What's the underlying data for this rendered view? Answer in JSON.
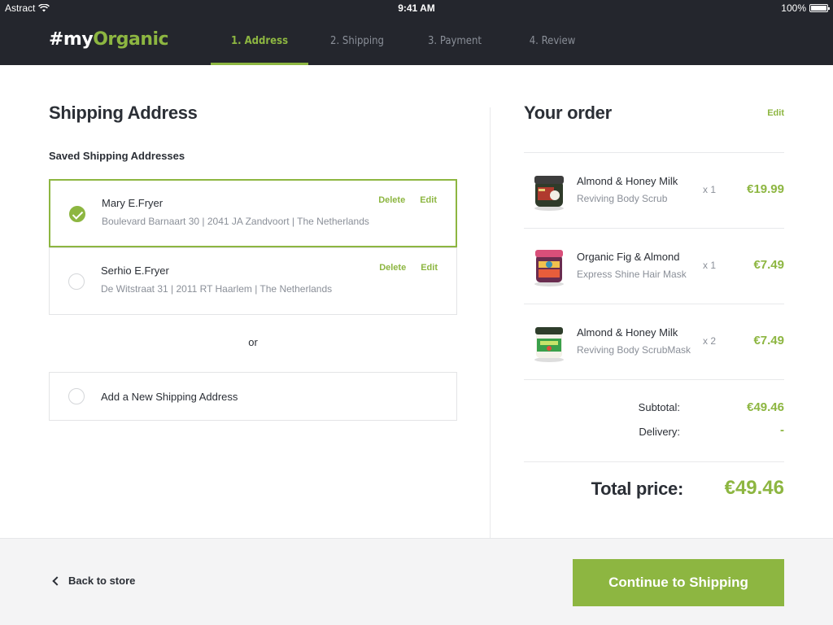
{
  "status_bar": {
    "carrier": "Astract",
    "time": "9:41 AM",
    "battery": "100%"
  },
  "brand": {
    "part1": "#my",
    "part2": "Organic",
    "accent": "#8db641"
  },
  "steps": [
    {
      "label": "1. Address",
      "active": true
    },
    {
      "label": "2. Shipping",
      "active": false
    },
    {
      "label": "3. Payment",
      "active": false
    },
    {
      "label": "4. Review",
      "active": false
    }
  ],
  "shipping": {
    "title": "Shipping Address",
    "saved_title": "Saved Shipping Addresses",
    "addresses": [
      {
        "name": "Mary E.Fryer",
        "line": "Boulevard Barnaart 30  |  2041 JA Zandvoort   |  The Netherlands",
        "delete": "Delete",
        "edit": "Edit",
        "selected": true
      },
      {
        "name": "Serhio E.Fryer",
        "line": "De Witstraat 31  |  2011 RT Haarlem   |  The Netherlands",
        "delete": "Delete",
        "edit": "Edit",
        "selected": false
      }
    ],
    "or": "or",
    "add_new": "Add a New Shipping Address"
  },
  "order": {
    "title": "Your order",
    "edit": "Edit",
    "items": [
      {
        "name": "Almond & Honey Milk",
        "desc": "Reviving Body Scrub",
        "qty": "x 1",
        "price": "€19.99",
        "icon": "jar-scrub-icon"
      },
      {
        "name": "Organic Fig & Almond",
        "desc": "Express Shine Hair Mask",
        "qty": "x 1",
        "price": "€7.49",
        "icon": "jar-fig-icon"
      },
      {
        "name": "Almond & Honey Milk",
        "desc": "Reviving Body ScrubMask",
        "qty": "x 2",
        "price": "€7.49",
        "icon": "jar-green-icon"
      }
    ],
    "subtotal_label": "Subtotal:",
    "subtotal": "€49.46",
    "delivery_label": "Delivery:",
    "delivery": "-",
    "total_label": "Total price:",
    "total": "€49.46"
  },
  "footer": {
    "back": "Back to store",
    "continue": "Continue to Shipping"
  }
}
